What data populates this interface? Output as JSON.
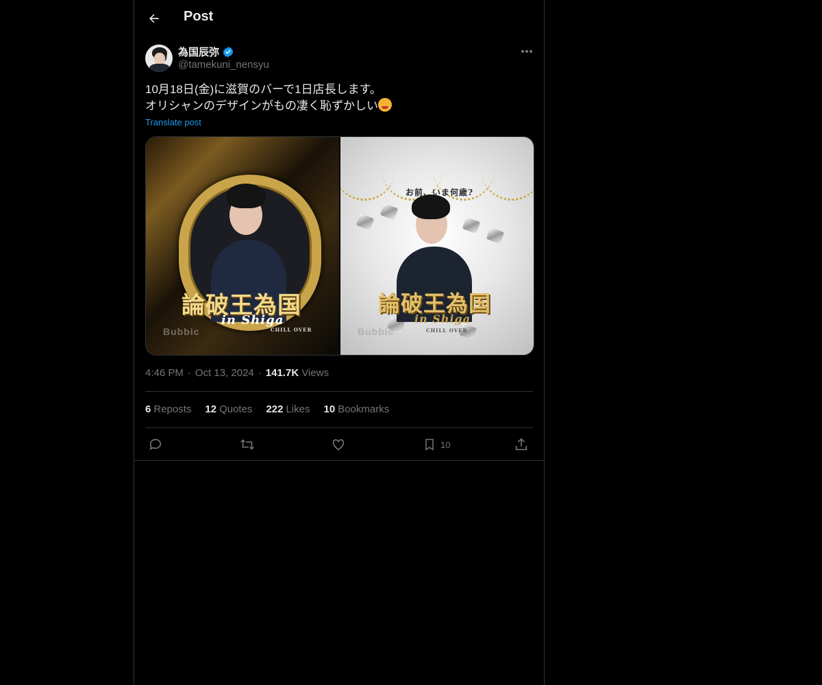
{
  "header": {
    "title": "Post",
    "back_icon": "arrow-left-icon"
  },
  "author": {
    "display_name": "為国辰弥",
    "handle": "@tamekuni_nensyu",
    "verified": true,
    "verified_color": "#1d9bf0"
  },
  "post": {
    "line1": "10月18日(金)に滋賀のバーで1日店長します。",
    "line2": "オリシャンのデザインがもの凄く恥ずかしい",
    "translate_label": "Translate post"
  },
  "media": {
    "left": {
      "watermark": "Bubbic",
      "title": "論破王為国",
      "subtitle": "in Shiga",
      "brand": "CHILL OVER"
    },
    "right": {
      "top_text": "お前、いま何歳?",
      "watermark": "Bubbic",
      "title": "論破王為国",
      "subtitle": "in Shiga",
      "brand": "CHILL OVER"
    }
  },
  "meta": {
    "time": "4:46 PM",
    "date": "Oct 13, 2024",
    "views_count": "141.7K",
    "views_label": "Views"
  },
  "stats": [
    {
      "count": "6",
      "label": "Reposts"
    },
    {
      "count": "12",
      "label": "Quotes"
    },
    {
      "count": "222",
      "label": "Likes"
    },
    {
      "count": "10",
      "label": "Bookmarks"
    }
  ],
  "actions": {
    "bookmark_count": "10"
  },
  "colors": {
    "background": "#000000",
    "text": "#e7e9ea",
    "muted": "#71767b",
    "link": "#1d9bf0",
    "border": "#2f3336"
  }
}
